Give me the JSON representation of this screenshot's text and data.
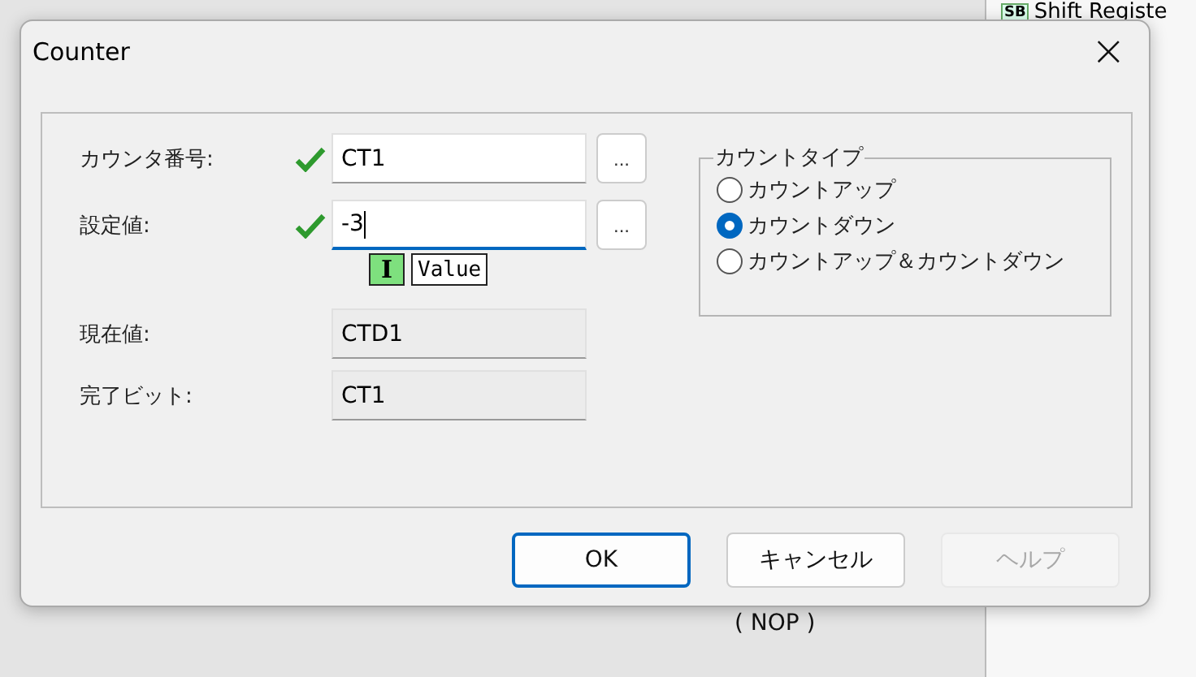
{
  "background": {
    "panel_item": {
      "badge": "SB",
      "label": "Shift Registe"
    },
    "instruction": "( NOP )"
  },
  "dialog": {
    "title": "Counter",
    "close": "×",
    "fields": [
      {
        "kind": "input",
        "label": "カウンタ番号:",
        "value": "CT1",
        "valid": true,
        "focused": false,
        "browse": "..."
      },
      {
        "kind": "input",
        "label": "設定値:",
        "value": "-3",
        "valid": true,
        "focused": true,
        "browse": "..."
      },
      {
        "kind": "readonly",
        "label": "現在値:",
        "value": "CTD1"
      },
      {
        "kind": "readonly",
        "label": "完了ビット:",
        "value": "CT1"
      }
    ],
    "hint": {
      "badge": "I",
      "text": "Value"
    },
    "count_type": {
      "title": "カウントタイプ",
      "options": [
        {
          "label": "カウントアップ",
          "selected": false
        },
        {
          "label": "カウントダウン",
          "selected": true
        },
        {
          "label": "カウントアップ＆カウントダウン",
          "selected": false
        }
      ]
    },
    "buttons": [
      {
        "label": "OK",
        "default": true,
        "disabled": false
      },
      {
        "label": "キャンセル",
        "default": false,
        "disabled": false
      },
      {
        "label": "ヘルプ",
        "default": false,
        "disabled": true
      }
    ]
  }
}
